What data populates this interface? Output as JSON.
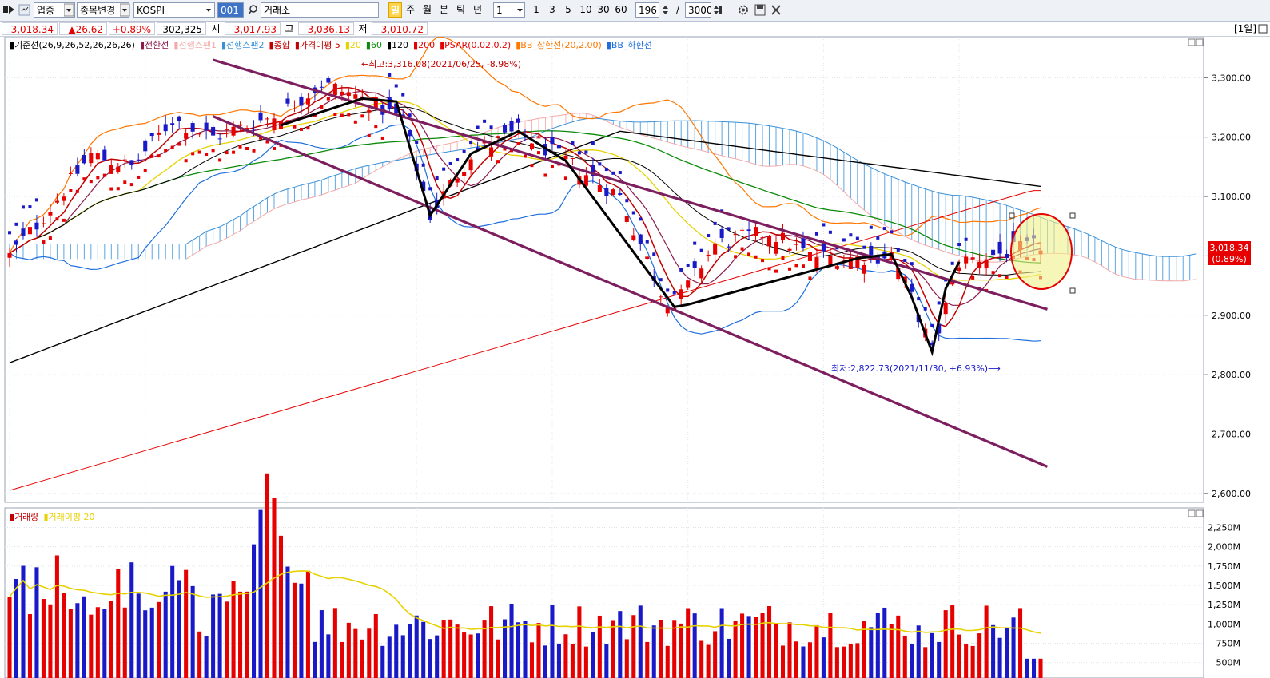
{
  "toolbar": {
    "market_label": "업종",
    "change_label": "종목변경",
    "symbol": "KOSPI",
    "code": "001",
    "exchange": "거래소",
    "period_buttons": [
      "일",
      "주",
      "월",
      "분",
      "틱",
      "년"
    ],
    "interval_value": "1",
    "interval_buttons": [
      "1",
      "3",
      "5",
      "10",
      "30",
      "60"
    ],
    "count_value": "196",
    "count_sep": "/",
    "count_total": "3000",
    "period_tag": "1일"
  },
  "info": {
    "price": "3,018.34",
    "change": "▲26.62",
    "change_pct": "+0.89%",
    "volume": "302,325",
    "open_label": "시",
    "open": "3,017.93",
    "high_label": "고",
    "high": "3,036.13",
    "low_label": "저",
    "low": "3,010.72"
  },
  "legend": [
    {
      "text": "기준선(26,9,26,52,26,26,26)",
      "color": "#000000"
    },
    {
      "text": "전환선",
      "color": "#8b1a4a"
    },
    {
      "text": "선행스팬1",
      "color": "#f2aaaa"
    },
    {
      "text": "선행스팬2",
      "color": "#3a90d8"
    },
    {
      "text": "종합",
      "color": "#c00000"
    },
    {
      "text": "가격이평 5",
      "color": "#c00000"
    },
    {
      "text": "20",
      "color": "#e6d200"
    },
    {
      "text": "60",
      "color": "#0a8a0a"
    },
    {
      "text": "120",
      "color": "#000000"
    },
    {
      "text": "200",
      "color": "#e60000"
    },
    {
      "text": "PSAR(0.02,0.2)",
      "color": "#e60000"
    },
    {
      "text": "BB_상한선(20,2.00)",
      "color": "#ff7700"
    },
    {
      "text": "BB_하한선",
      "color": "#1e6fdc"
    }
  ],
  "volume_legend": [
    {
      "text": "거래량",
      "color": "#c00000"
    },
    {
      "text": "거래이평 20",
      "color": "#e6d200"
    }
  ],
  "colors": {
    "up": "#e60000",
    "down": "#1919c8",
    "channel": "#7d1f5e",
    "zigzag": "#000000"
  },
  "chart_data": [
    {
      "type": "candlestick",
      "title": "KOSPI",
      "y_axis_ticks": [
        "3,300.00",
        "3,200.00",
        "3,100.00",
        "3,000.00",
        "2,900.00",
        "2,800.00",
        "2,700.00",
        "2,600.00"
      ],
      "ylim": [
        2585,
        3365
      ],
      "x_count": 153,
      "annotations": {
        "high": "←최고:3,316.08(2021/06/25, -8.98%)",
        "low": "최저:2,822.73(2021/11/30, +6.93%)⟶"
      },
      "current_price_label": "3,018.34",
      "current_change_label": "(0.89%)",
      "trendlines": [
        {
          "name": "channel-upper",
          "points": [
            [
              30,
              3330
            ],
            [
              153,
              2910
            ]
          ]
        },
        {
          "name": "channel-lower",
          "points": [
            [
              30,
              3235
            ],
            [
              153,
              2645
            ]
          ]
        }
      ],
      "zigzag": [
        [
          40,
          3220
        ],
        [
          52,
          3265
        ],
        [
          57,
          3260
        ],
        [
          62,
          3068
        ],
        [
          68,
          3172
        ],
        [
          75,
          3210
        ],
        [
          82,
          3160
        ],
        [
          98,
          2914
        ],
        [
          100,
          2918
        ],
        [
          125,
          2996
        ],
        [
          130,
          3003
        ],
        [
          133,
          2930
        ],
        [
          136,
          2838
        ],
        [
          138,
          2945
        ],
        [
          140,
          2990
        ]
      ]
    },
    {
      "type": "bar",
      "title": "거래량",
      "y_axis_ticks": [
        "2,250M",
        "2,000M",
        "1,750M",
        "1,500M",
        "1,250M",
        "1,000M",
        "750M",
        "500M"
      ],
      "ylim": [
        300,
        2400
      ],
      "x_count": 153
    }
  ]
}
